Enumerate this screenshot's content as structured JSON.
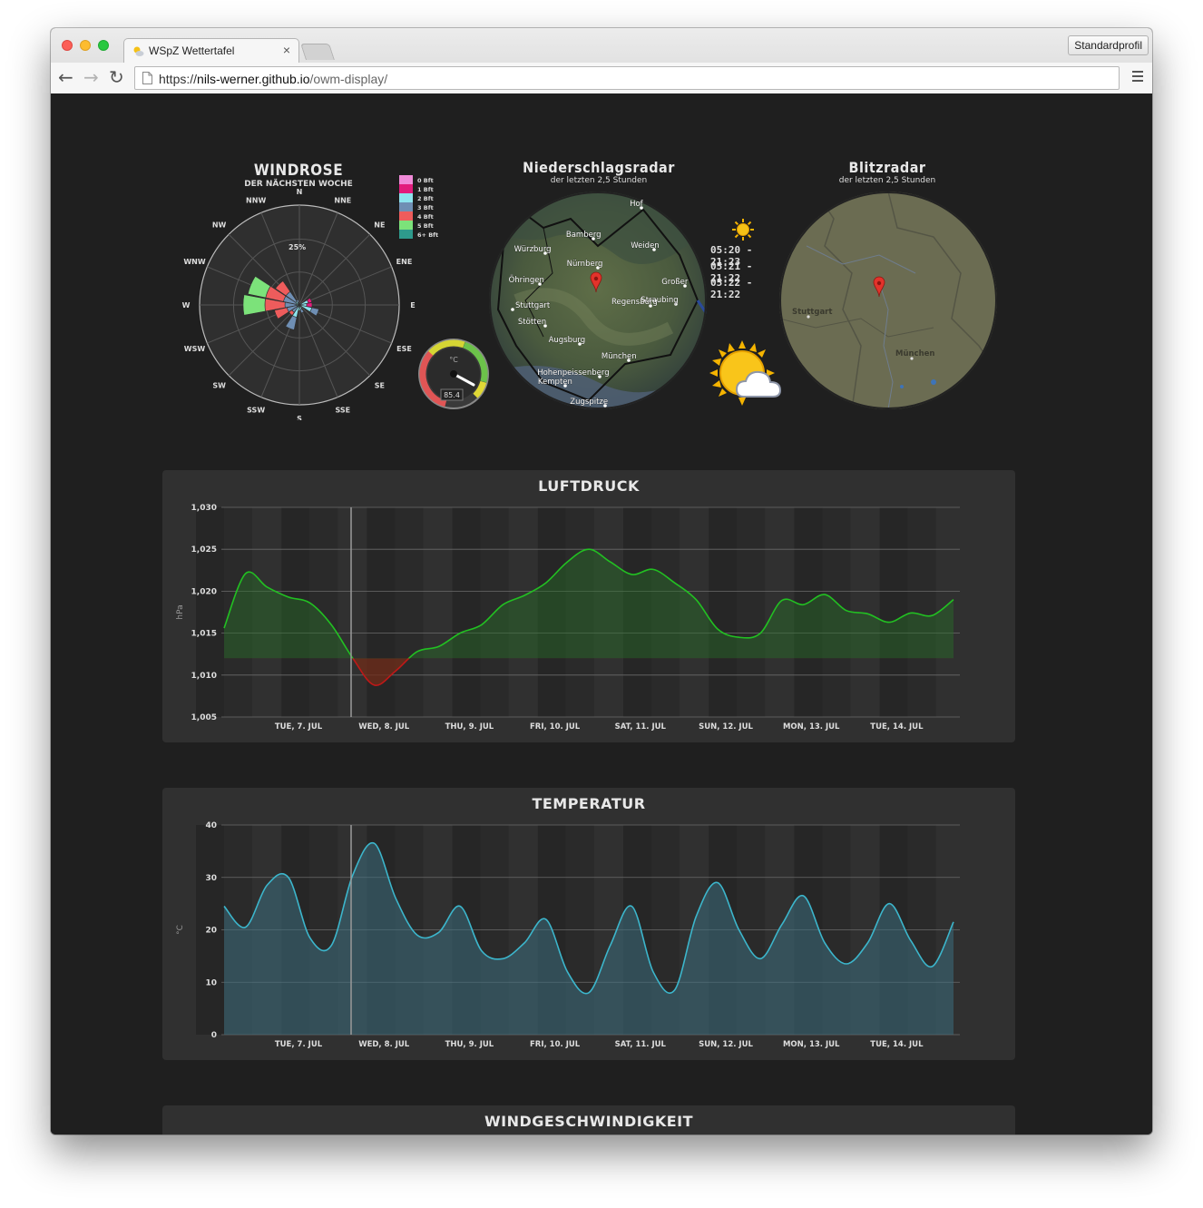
{
  "browser": {
    "tab_title": "WSpZ Wettertafel",
    "tab_close": "×",
    "profile_label": "Standardprofil",
    "url_scheme": "https://",
    "url_host": "nils-werner.github.io",
    "url_path": "/owm-display/",
    "nav_back": "←",
    "nav_forward": "→",
    "nav_reload": "↻"
  },
  "windrose": {
    "title": "WINDROSE",
    "subtitle": "DER NÄCHSTEN WOCHE",
    "directions": [
      "N",
      "NNE",
      "NE",
      "ENE",
      "E",
      "ESE",
      "SE",
      "SSE",
      "S",
      "SSW",
      "SW",
      "WSW",
      "W",
      "WNW",
      "NW",
      "NNW"
    ],
    "ring_label": "25%",
    "legend": [
      {
        "label": "0 Bft",
        "color": "#f08ad8"
      },
      {
        "label": "1 Bft",
        "color": "#e21c7c"
      },
      {
        "label": "2 Bft",
        "color": "#8de4ee"
      },
      {
        "label": "3 Bft",
        "color": "#6f8fb4"
      },
      {
        "label": "4 Bft",
        "color": "#ee5c5c"
      },
      {
        "label": "5 Bft",
        "color": "#7ce27a"
      },
      {
        "label": "6+ Bft",
        "color": "#2e9a8c"
      }
    ]
  },
  "gauge": {
    "unit": "°C",
    "value": "85.4"
  },
  "radar": {
    "title": "Niederschlagsradar",
    "subtitle": "der letzten 2,5 Stunden",
    "cities": [
      "Hof",
      "Bamberg",
      "Würzburg",
      "Weiden",
      "Nürnberg",
      "Öhringen",
      "Großer",
      "Stuttgart",
      "Regensburg",
      "Straubing",
      "Stötten",
      "Augsburg",
      "München",
      "Hohenpeissenberg",
      "Kempten",
      "Zugspitze"
    ]
  },
  "sun": {
    "times": [
      "05:20 - 21:23",
      "05:21 - 21:22",
      "05:22 - 21:22"
    ]
  },
  "lightning": {
    "title": "Blitzradar",
    "subtitle": "der letzten 2,5 Stunden",
    "cities": [
      "Stuttgart",
      "München"
    ]
  },
  "days": [
    "TUE, 7. JUL",
    "WED, 8. JUL",
    "THU, 9. JUL",
    "FRI, 10. JUL",
    "SAT, 11. JUL",
    "SUN, 12. JUL",
    "MON, 13. JUL",
    "TUE, 14. JUL"
  ],
  "pressure": {
    "title": "LUFTDRUCK",
    "ylabel": "hPa",
    "yticks": [
      "1,030",
      "1,025",
      "1,020",
      "1,015",
      "1,010",
      "1,005"
    ]
  },
  "temperature": {
    "title": "TEMPERATUR",
    "ylabel": "°C",
    "yticks": [
      "40",
      "30",
      "20",
      "10",
      "0"
    ]
  },
  "windspeed": {
    "title": "WINDGESCHWINDIGKEIT"
  },
  "chart_data": [
    {
      "type": "area",
      "title": "LUFTDRUCK",
      "ylabel": "hPa",
      "ylim": [
        1005,
        1030
      ],
      "baseline": 1012,
      "x": [
        "Mon 6. Jul 12:00",
        "Mon 6. Jul 18:00",
        "Tue 7. Jul 00:00",
        "Tue 7. Jul 06:00",
        "Tue 7. Jul 12:00",
        "Tue 7. Jul 18:00",
        "Wed 8. Jul 00:00",
        "Wed 8. Jul 06:00",
        "Wed 8. Jul 12:00",
        "Wed 8. Jul 18:00",
        "Thu 9. Jul 00:00",
        "Thu 9. Jul 06:00",
        "Thu 9. Jul 12:00",
        "Thu 9. Jul 18:00",
        "Fri 10. Jul 00:00",
        "Fri 10. Jul 06:00",
        "Fri 10. Jul 12:00",
        "Fri 10. Jul 18:00",
        "Sat 11. Jul 00:00",
        "Sat 11. Jul 06:00",
        "Sat 11. Jul 12:00",
        "Sat 11. Jul 18:00",
        "Sun 12. Jul 00:00",
        "Sun 12. Jul 06:00",
        "Sun 12. Jul 12:00",
        "Sun 12. Jul 18:00",
        "Mon 13. Jul 00:00",
        "Mon 13. Jul 06:00",
        "Mon 13. Jul 12:00",
        "Mon 13. Jul 18:00",
        "Tue 14. Jul 00:00",
        "Tue 14. Jul 06:00",
        "Tue 14. Jul 12:00",
        "Tue 14. Jul 18:00",
        "Wed 15. Jul 00:00"
      ],
      "series": [
        {
          "values": [
            1015.6,
            1022.1,
            1020.5,
            1019.3,
            1018.6,
            1016.0,
            1012.0,
            1008.8,
            1010.5,
            1012.8,
            1013.4,
            1015.0,
            1016.0,
            1018.4,
            1019.5,
            1021.0,
            1023.5,
            1025.0,
            1023.5,
            1022.0,
            1022.6,
            1021.0,
            1019.0,
            1015.5,
            1014.5,
            1015.0,
            1018.9,
            1018.4,
            1019.6,
            1017.7,
            1017.3,
            1016.3,
            1017.4,
            1017.1,
            1019.0
          ]
        }
      ]
    },
    {
      "type": "area",
      "title": "TEMPERATUR",
      "ylabel": "°C",
      "ylim": [
        0,
        40
      ],
      "x": [
        "Mon 6. Jul 12:00",
        "Mon 6. Jul 18:00",
        "Tue 7. Jul 00:00",
        "Tue 7. Jul 06:00",
        "Tue 7. Jul 12:00",
        "Tue 7. Jul 18:00",
        "Wed 8. Jul 00:00",
        "Wed 8. Jul 06:00",
        "Wed 8. Jul 12:00",
        "Wed 8. Jul 18:00",
        "Thu 9. Jul 00:00",
        "Thu 9. Jul 06:00",
        "Thu 9. Jul 12:00",
        "Thu 9. Jul 18:00",
        "Fri 10. Jul 00:00",
        "Fri 10. Jul 06:00",
        "Fri 10. Jul 12:00",
        "Fri 10. Jul 18:00",
        "Sat 11. Jul 00:00",
        "Sat 11. Jul 06:00",
        "Sat 11. Jul 12:00",
        "Sat 11. Jul 18:00",
        "Sun 12. Jul 00:00",
        "Sun 12. Jul 06:00",
        "Sun 12. Jul 12:00",
        "Sun 12. Jul 18:00",
        "Mon 13. Jul 00:00",
        "Mon 13. Jul 06:00",
        "Mon 13. Jul 12:00",
        "Mon 13. Jul 18:00",
        "Tue 14. Jul 00:00",
        "Tue 14. Jul 06:00",
        "Tue 14. Jul 12:00",
        "Tue 14. Jul 18:00",
        "Wed 15. Jul 00:00"
      ],
      "series": [
        {
          "values": [
            24.5,
            20.5,
            28.5,
            30.0,
            18.5,
            17.0,
            30.5,
            36.5,
            26.0,
            19.0,
            19.5,
            24.5,
            16.0,
            14.5,
            17.5,
            22.0,
            12.0,
            8.0,
            17.0,
            24.5,
            12.0,
            8.5,
            22.5,
            29.0,
            20.0,
            14.5,
            21.0,
            26.5,
            17.5,
            13.5,
            17.5,
            25.0,
            18.0,
            13.0,
            21.5
          ]
        }
      ]
    }
  ]
}
